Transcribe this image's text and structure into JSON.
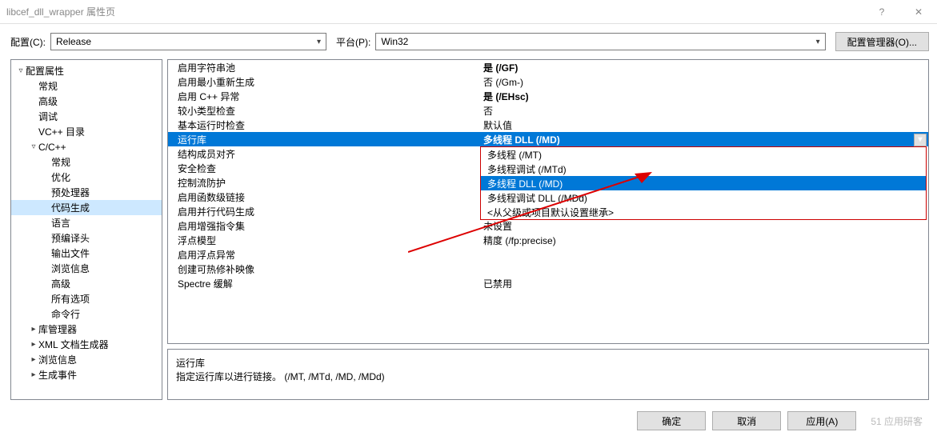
{
  "window": {
    "title": "libcef_dll_wrapper 属性页",
    "help": "?",
    "close": "✕"
  },
  "topbar": {
    "config_label": "配置(C):",
    "config_value": "Release",
    "platform_label": "平台(P):",
    "platform_value": "Win32",
    "config_mgr": "配置管理器(O)..."
  },
  "tree": {
    "root": "配置属性",
    "items": [
      "常规",
      "高级",
      "调试",
      "VC++ 目录"
    ],
    "cpp": "C/C++",
    "cpp_items": [
      "常规",
      "优化",
      "预处理器",
      "代码生成",
      "语言",
      "预编译头",
      "输出文件",
      "浏览信息",
      "高级",
      "所有选项",
      "命令行"
    ],
    "cpp_selected_index": 3,
    "tail": [
      "库管理器",
      "XML 文档生成器",
      "浏览信息",
      "生成事件"
    ]
  },
  "props": [
    {
      "name": "启用字符串池",
      "value": "是 (/GF)",
      "bold": true
    },
    {
      "name": "启用最小重新生成",
      "value": "否 (/Gm-)",
      "bold": false
    },
    {
      "name": "启用 C++ 异常",
      "value": "是 (/EHsc)",
      "bold": true
    },
    {
      "name": "较小类型检查",
      "value": "否",
      "bold": false
    },
    {
      "name": "基本运行时检查",
      "value": "默认值",
      "bold": false
    },
    {
      "name": "运行库",
      "value": "多线程 DLL (/MD)",
      "bold": true,
      "selected": true
    },
    {
      "name": "结构成员对齐",
      "value": "",
      "bold": false
    },
    {
      "name": "安全检查",
      "value": "",
      "bold": false
    },
    {
      "name": "控制流防护",
      "value": "",
      "bold": false
    },
    {
      "name": "启用函数级链接",
      "value": "",
      "bold": false
    },
    {
      "name": "启用并行代码生成",
      "value": "",
      "bold": false
    },
    {
      "name": "启用增强指令集",
      "value": "未设置",
      "bold": false
    },
    {
      "name": "浮点模型",
      "value": "精度 (/fp:precise)",
      "bold": false
    },
    {
      "name": "启用浮点异常",
      "value": "",
      "bold": false
    },
    {
      "name": "创建可热修补映像",
      "value": "",
      "bold": false
    },
    {
      "name": "Spectre 缓解",
      "value": "已禁用",
      "bold": false
    }
  ],
  "dropdown": {
    "options": [
      "多线程 (/MT)",
      "多线程调试 (/MTd)",
      "多线程 DLL (/MD)",
      "多线程调试 DLL (/MDd)",
      "<从父级或项目默认设置继承>"
    ],
    "selected_index": 2
  },
  "description": {
    "name": "运行库",
    "text": "指定运行库以进行链接。     (/MT, /MTd, /MD, /MDd)"
  },
  "footer": {
    "ok": "确定",
    "cancel": "取消",
    "apply": "应用(A)",
    "watermark": "51 应用研客"
  }
}
